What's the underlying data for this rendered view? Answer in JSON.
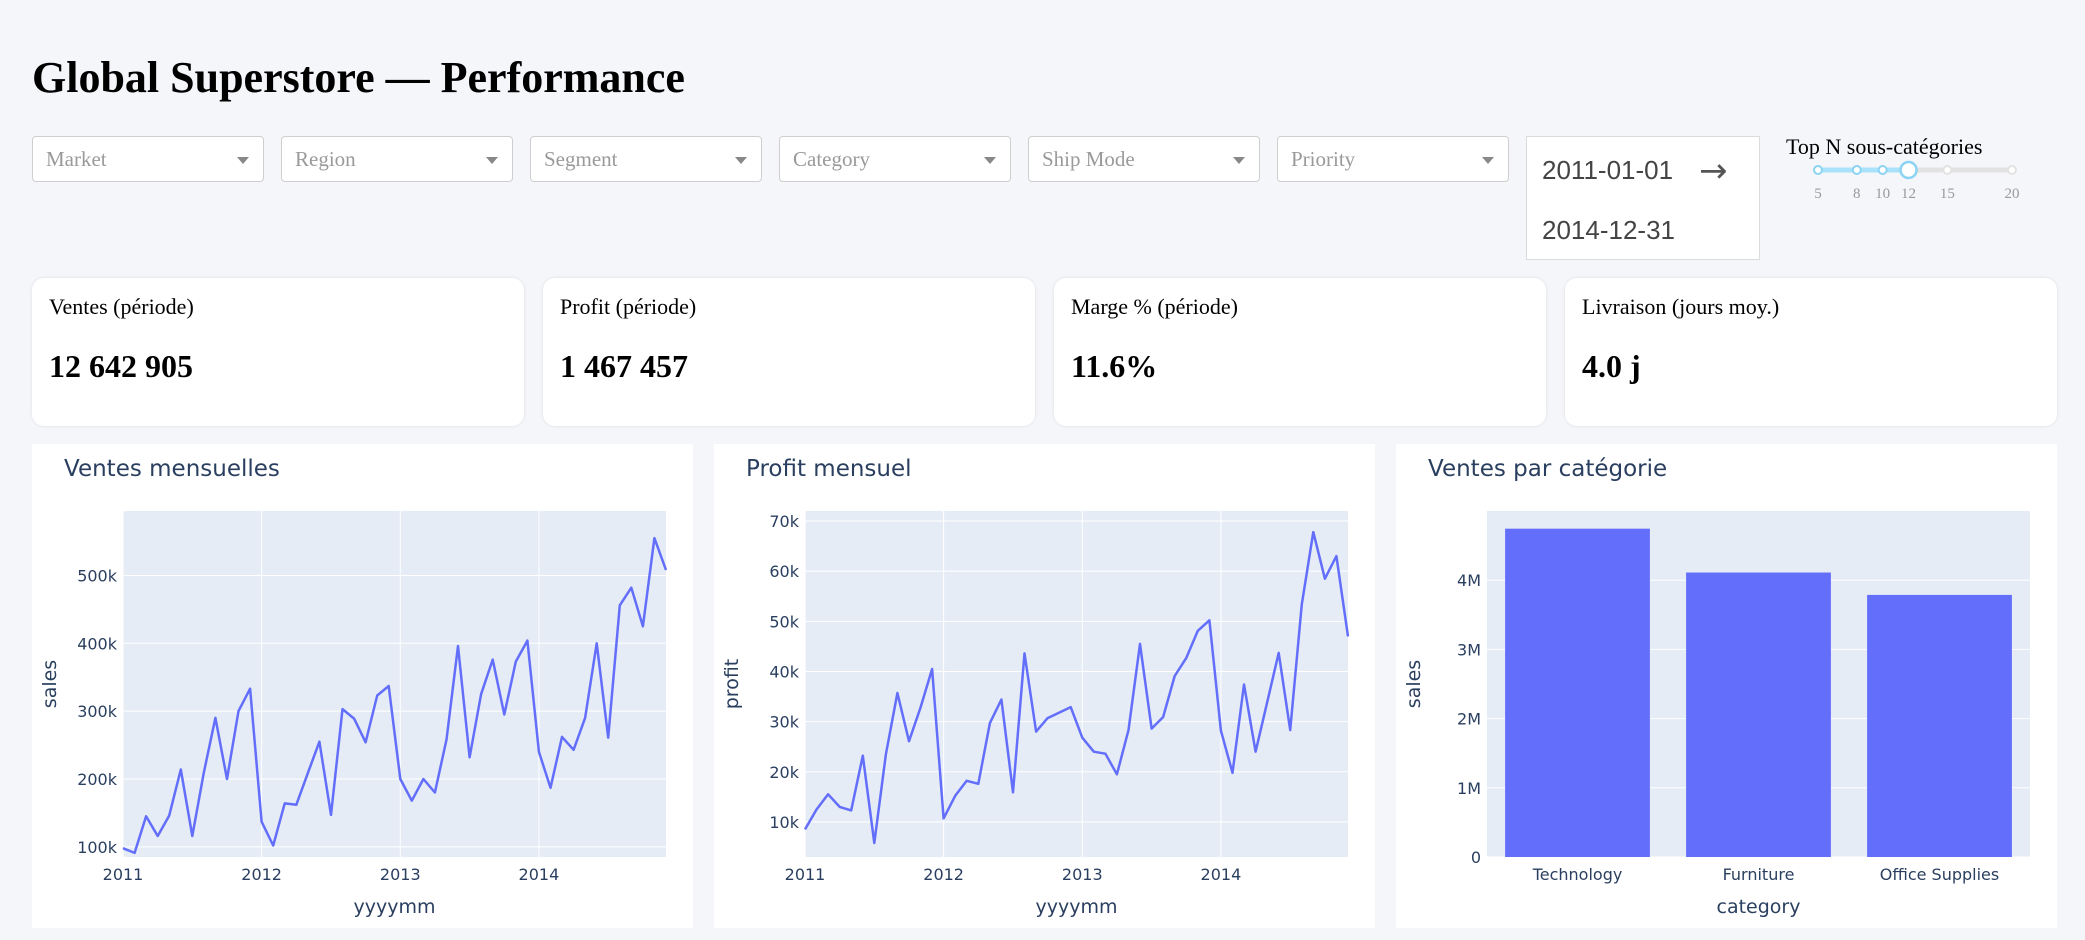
{
  "header": {
    "title": "Global Superstore — Performance"
  },
  "filters": [
    {
      "placeholder": "Market"
    },
    {
      "placeholder": "Region"
    },
    {
      "placeholder": "Segment"
    },
    {
      "placeholder": "Category"
    },
    {
      "placeholder": "Ship Mode"
    },
    {
      "placeholder": "Priority"
    }
  ],
  "date_range": {
    "start": "2011-01-01",
    "end": "2014-12-31",
    "arrow": "→"
  },
  "top_n": {
    "label": "Top N sous-catégories",
    "min": 5,
    "max": 20,
    "value": 12,
    "marks": [
      "5",
      "8",
      "10",
      "12",
      "15",
      "20"
    ]
  },
  "kpis": [
    {
      "label": "Ventes (période)",
      "value": "12 642 905"
    },
    {
      "label": "Profit (période)",
      "value": "1 467 457"
    },
    {
      "label": "Marge % (période)",
      "value": "11.6%"
    },
    {
      "label": "Livraison (jours moy.)",
      "value": "4.0 j"
    }
  ],
  "colors": {
    "series": "#636efa",
    "plot_bg": "#e5ecf6",
    "text": "#2a3f5f",
    "grid": "#ffffff"
  },
  "chart_data": [
    {
      "type": "line",
      "title": "Ventes mensuelles",
      "xlabel": "yyyymm",
      "ylabel": "sales",
      "x_ticks": [
        "2011",
        "2012",
        "2013",
        "2014"
      ],
      "y_ticks": [
        "100k",
        "200k",
        "300k",
        "400k",
        "500k"
      ],
      "ylim": [
        85000,
        595000
      ],
      "x_start": "2011-01",
      "values": [
        98000,
        91000,
        145000,
        116000,
        146000,
        214000,
        116000,
        210000,
        290000,
        200000,
        300000,
        333000,
        137000,
        102000,
        164000,
        162000,
        209000,
        255000,
        147000,
        303000,
        289000,
        254000,
        323000,
        337000,
        200000,
        168000,
        200000,
        180000,
        258000,
        396000,
        232000,
        325000,
        376000,
        295000,
        373000,
        404000,
        240000,
        187000,
        262000,
        243000,
        290000,
        400000,
        261000,
        456000,
        482000,
        425000,
        555000,
        508000
      ]
    },
    {
      "type": "line",
      "title": "Profit mensuel",
      "xlabel": "yyyymm",
      "ylabel": "profit",
      "x_ticks": [
        "2011",
        "2012",
        "2013",
        "2014"
      ],
      "y_ticks": [
        "10k",
        "20k",
        "30k",
        "40k",
        "50k",
        "60k",
        "70k"
      ],
      "ylim": [
        3000,
        72000
      ],
      "x_start": "2011-01",
      "values": [
        8500,
        12500,
        15500,
        13000,
        12300,
        23200,
        5800,
        23500,
        35700,
        26100,
        32800,
        40500,
        10700,
        15200,
        18200,
        17600,
        29700,
        34400,
        15900,
        43600,
        28000,
        30700,
        31800,
        32900,
        26800,
        24000,
        23600,
        19500,
        28300,
        45500,
        28600,
        30900,
        39100,
        42700,
        48100,
        50200,
        28200,
        19800,
        37400,
        24000,
        33800,
        43700,
        28300,
        53400,
        67800,
        58500,
        63000,
        47000
      ]
    },
    {
      "type": "bar",
      "title": "Ventes par catégorie",
      "xlabel": "category",
      "ylabel": "sales",
      "categories": [
        "Technology",
        "Furniture",
        "Office Supplies"
      ],
      "values": [
        4744557,
        4110874,
        3787492
      ],
      "y_ticks": [
        "0",
        "1M",
        "2M",
        "3M",
        "4M"
      ],
      "ylim": [
        0,
        5000000
      ]
    }
  ]
}
